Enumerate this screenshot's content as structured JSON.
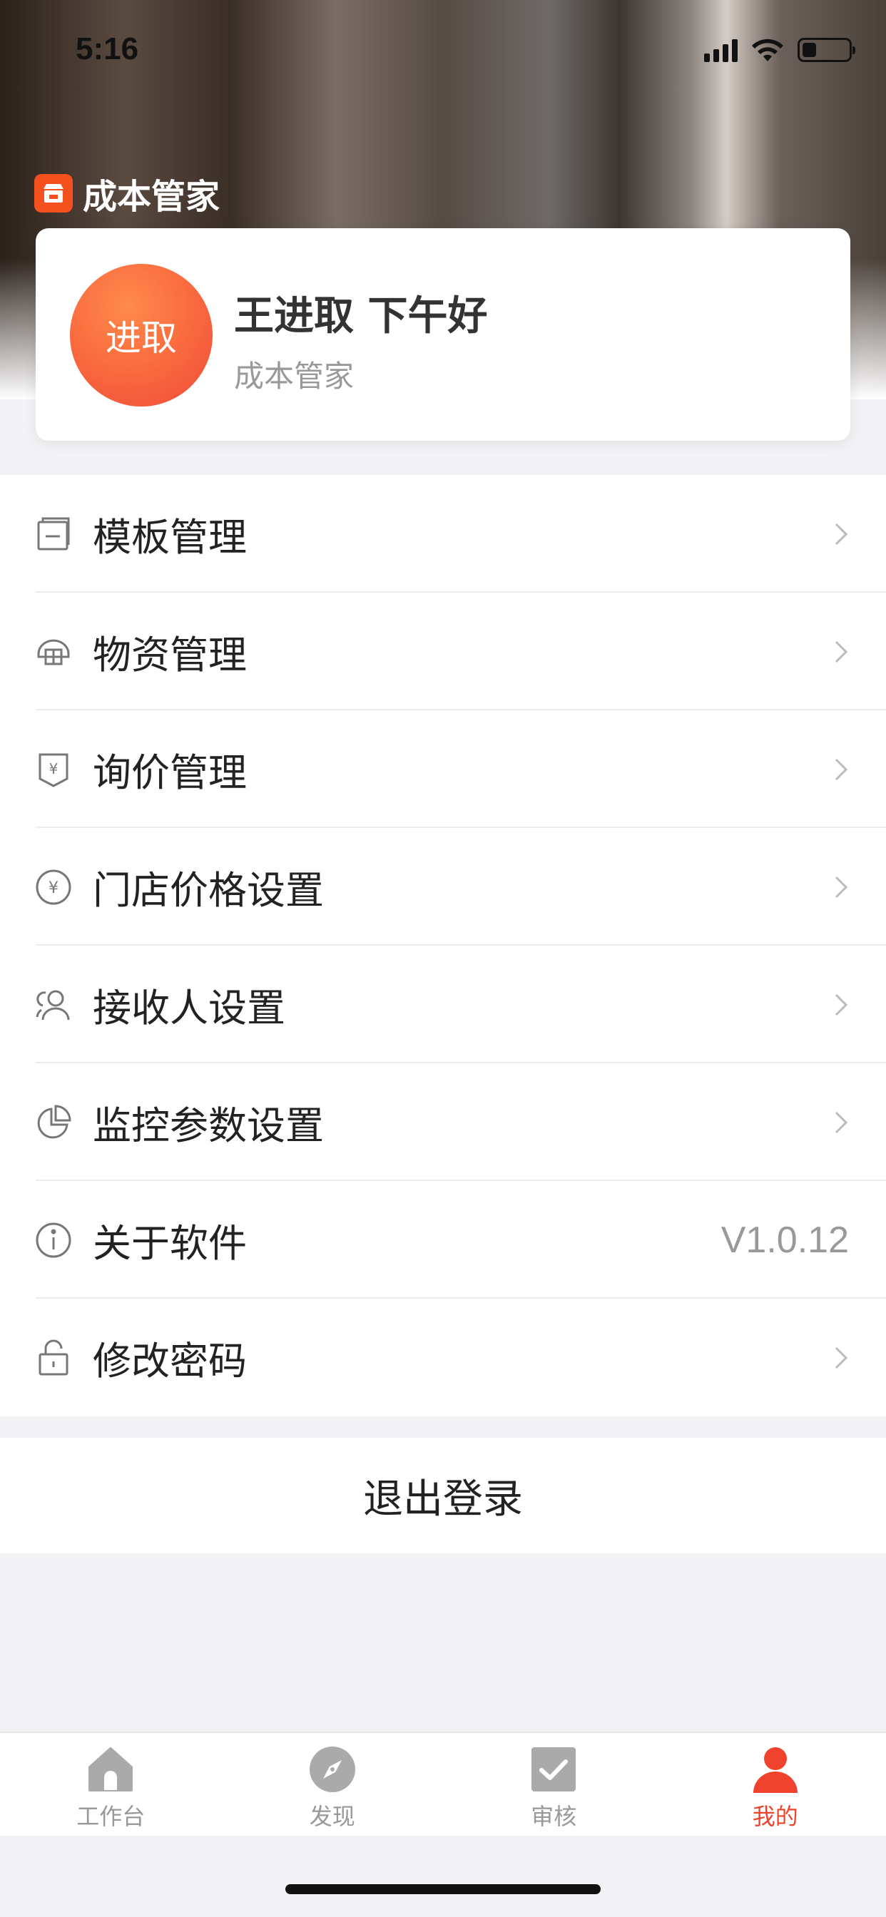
{
  "status": {
    "time": "5:16",
    "battery_level": 0.3
  },
  "brand": {
    "name": "成本管家"
  },
  "profile": {
    "avatar_text": "进取",
    "greeting": "王进取 下午好",
    "subtitle": "成本管家"
  },
  "menu": {
    "items": [
      {
        "label": "模板管理",
        "icon": "template-icon"
      },
      {
        "label": "物资管理",
        "icon": "materials-icon"
      },
      {
        "label": "询价管理",
        "icon": "inquiry-icon"
      },
      {
        "label": "门店价格设置",
        "icon": "store-price-icon"
      },
      {
        "label": "接收人设置",
        "icon": "recipients-icon"
      },
      {
        "label": "监控参数设置",
        "icon": "monitor-icon"
      },
      {
        "label": "关于软件",
        "icon": "info-icon",
        "value": "V1.0.12"
      },
      {
        "label": "修改密码",
        "icon": "lock-icon"
      }
    ]
  },
  "logout": {
    "label": "退出登录"
  },
  "tabbar": {
    "tabs": [
      {
        "label": "工作台",
        "icon": "home-icon",
        "active": false
      },
      {
        "label": "发现",
        "icon": "compass-icon",
        "active": false
      },
      {
        "label": "审核",
        "icon": "checkbox-icon",
        "active": false
      },
      {
        "label": "我的",
        "icon": "person-icon",
        "active": true
      }
    ]
  },
  "colors": {
    "accent": "#f0432d",
    "brand_orange": "#f96a3e",
    "inactive": "#999999"
  }
}
